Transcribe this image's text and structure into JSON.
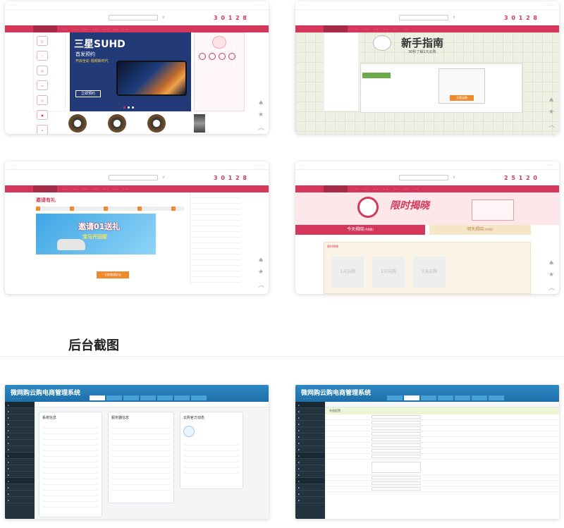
{
  "section_title": "后台截图",
  "shot1": {
    "counter": "3 0 1 2 8",
    "banner_title": "三星SUHD",
    "banner_sub": "首发预约",
    "banner_desc": "开启全彩 视频新时代",
    "banner_btn": "立即预约",
    "colors": {
      "brand": "#d4375a",
      "banner_bg": "#233a78"
    }
  },
  "shot2": {
    "counter": "3 0 1 2 8",
    "guide_title": "新手指南",
    "guide_sub": "30秒了解1元云购",
    "button": "立即云购"
  },
  "shot3": {
    "counter": "3 0 1 2 8",
    "headline": "邀请有礼",
    "promo_text": "邀请01送礼",
    "promo_sub": "宝马开回家",
    "cta": "立即邀请好友"
  },
  "shot4": {
    "counter": "2 5 1 2 0",
    "banner_text": "限时揭晓",
    "tab_active": "今天揭晓",
    "tab_active_count": "(共8期)",
    "tab_other": "明天揭晓",
    "tab_other_count": "(共0期)",
    "panel_title": "限时揭晓",
    "tiles": [
      "1元云购",
      "1元云购",
      "1元云购"
    ]
  },
  "admin1": {
    "title": "微网购云购电商管理系统",
    "panel1": "系统信息",
    "panel2": "服务器信息",
    "panel3": "云购官方动态"
  },
  "admin2": {
    "title": "微网购云购电商管理系统",
    "form_title": "系统配置"
  }
}
